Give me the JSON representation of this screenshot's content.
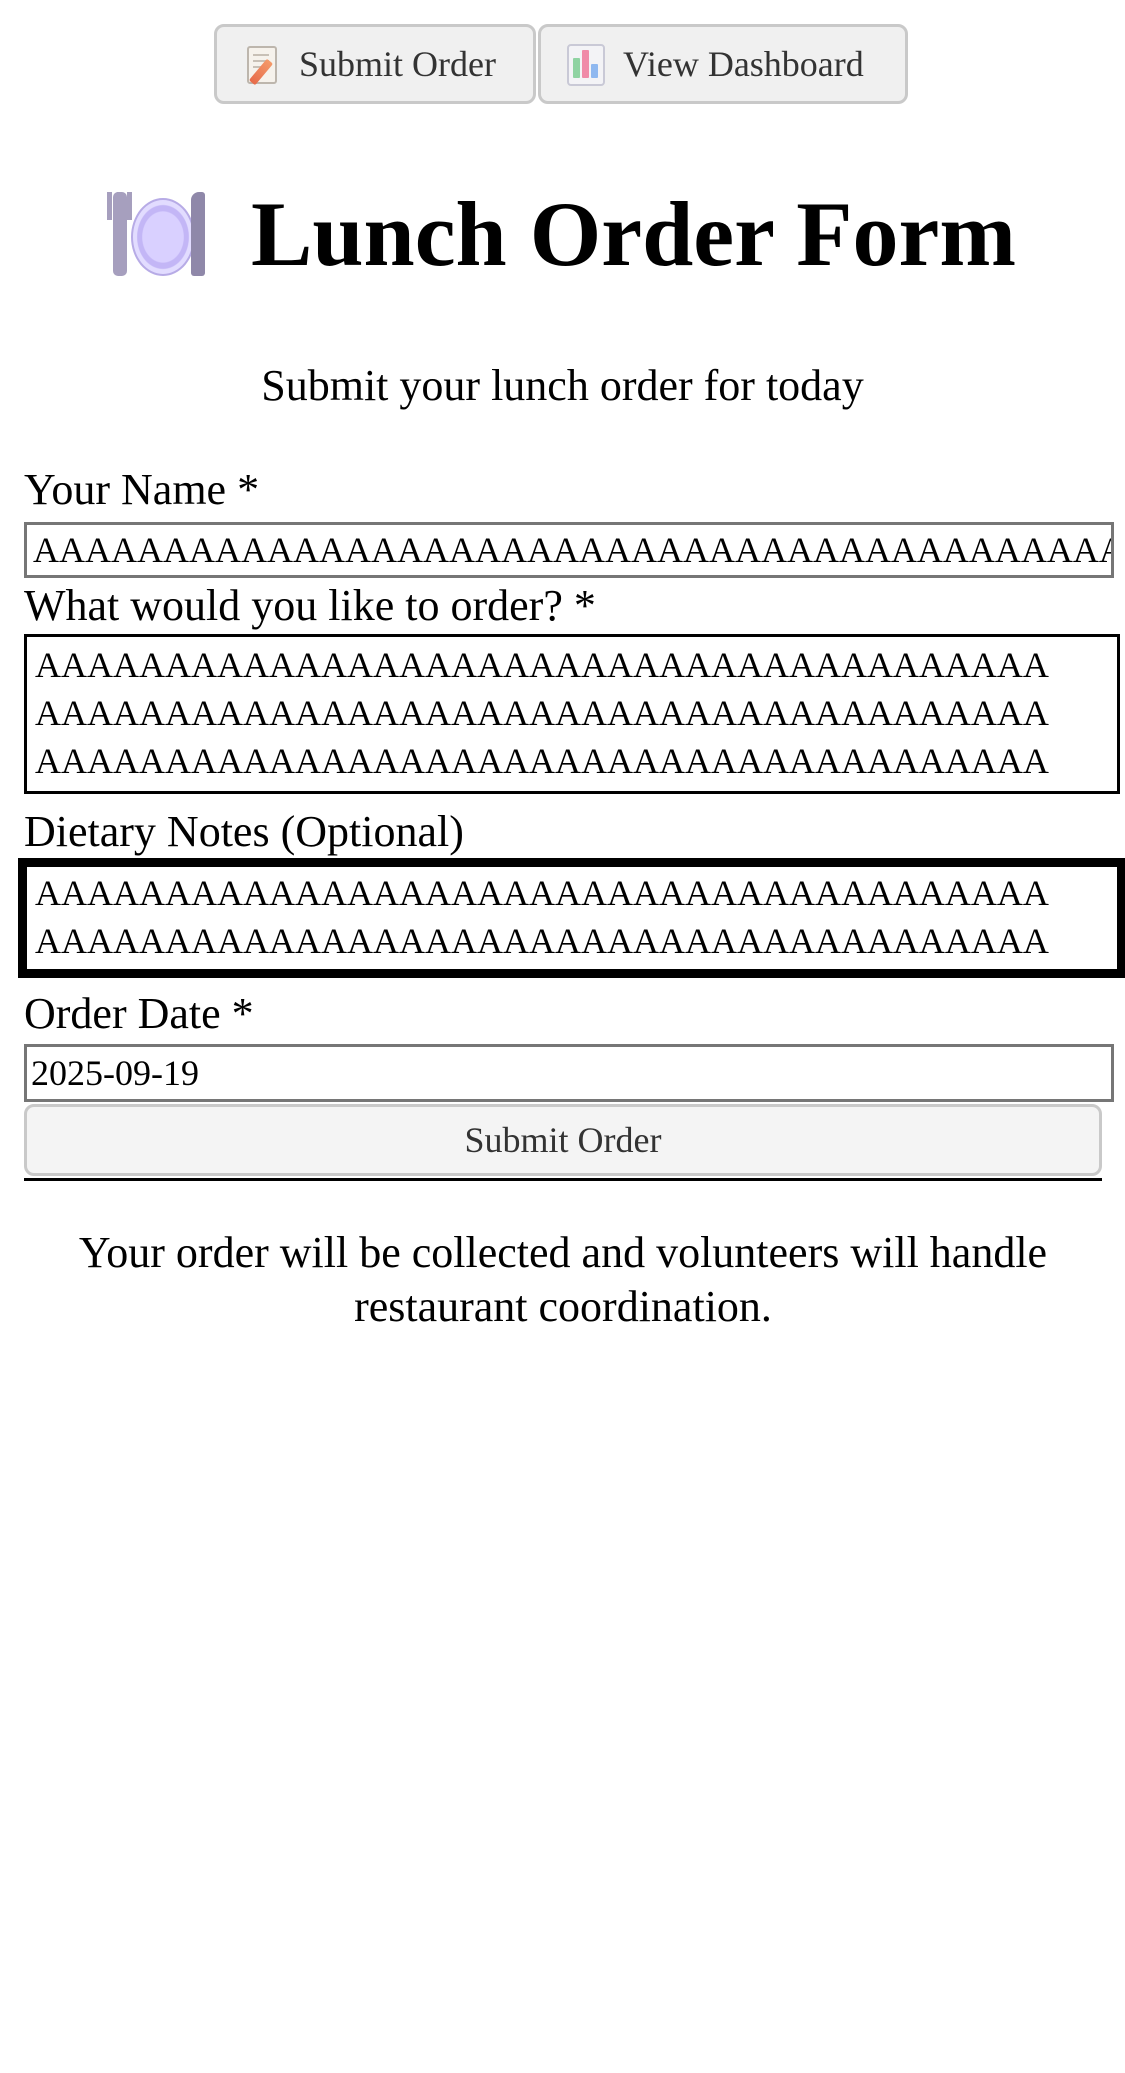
{
  "nav": {
    "submit_label": "Submit Order",
    "submit_icon": "memo-icon",
    "dashboard_label": "View Dashboard",
    "dashboard_icon": "bar-chart-icon"
  },
  "header": {
    "icon": "fork-knife-plate-icon",
    "title": "Lunch Order Form",
    "subtitle": "Submit your lunch order for today"
  },
  "form": {
    "name_label": "Your Name *",
    "name_value": "AAAAAAAAAAAAAAAAAAAAAAAAAAAAAAAAAAAAAAAAAAAAAAAA",
    "order_label": "What would you like to order? *",
    "order_value": "AAAAAAAAAAAAAAAAAAAAAAAAAAAAAAAAAAAAAAA\nAAAAAAAAAAAAAAAAAAAAAAAAAAAAAAAAAAAAAAA\nAAAAAAAAAAAAAAAAAAAAAAAAAAAAAAAAAAAAAAA",
    "dietary_label": "Dietary Notes (Optional)",
    "dietary_value": "AAAAAAAAAAAAAAAAAAAAAAAAAAAAAAAAAAAAAAA\nAAAAAAAAAAAAAAAAAAAAAAAAAAAAAAAAAAAAAAA",
    "date_label": "Order Date *",
    "date_value": "2025-09-19",
    "submit_label": "Submit Order"
  },
  "footer": {
    "note": "Your order will be collected and volunteers will handle restaurant coordination."
  }
}
